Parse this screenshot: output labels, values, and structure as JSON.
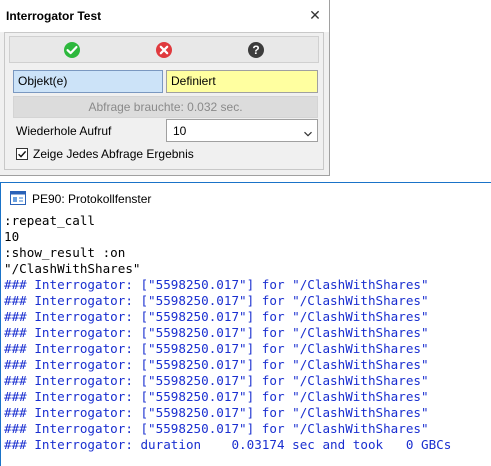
{
  "dialog": {
    "title": "Interrogator Test",
    "close_glyph": "✕",
    "icons": [
      "check-icon",
      "cancel-icon",
      "help-icon"
    ],
    "colors": {
      "check": "#2db83d",
      "cancel": "#e03a3e",
      "help": "#3c3c3c"
    },
    "objekt_label": "Objekt(e)",
    "objekt_value": "Definiert",
    "timing_text": "Abfrage brauchte:   0.032 sec.",
    "repeat_label": "Wiederhole Aufruf",
    "repeat_value": "10",
    "show_results_label": "Zeige Jedes Abfrage Ergebnis",
    "show_results_checked": true
  },
  "log": {
    "title": "PE90: Protokollfenster",
    "colors": {
      "plain": "#000000",
      "hash": "#1a2fd0"
    },
    "lines": [
      {
        "text": ":repeat_call",
        "style": "plain"
      },
      {
        "text": "10",
        "style": "plain"
      },
      {
        "text": ":show_result :on",
        "style": "plain"
      },
      {
        "text": "\"/ClashWithShares\"",
        "style": "plain"
      },
      {
        "text": "### Interrogator: [\"5598250.017\"] for \"/ClashWithShares\"",
        "style": "hash"
      },
      {
        "text": "### Interrogator: [\"5598250.017\"] for \"/ClashWithShares\"",
        "style": "hash"
      },
      {
        "text": "### Interrogator: [\"5598250.017\"] for \"/ClashWithShares\"",
        "style": "hash"
      },
      {
        "text": "### Interrogator: [\"5598250.017\"] for \"/ClashWithShares\"",
        "style": "hash"
      },
      {
        "text": "### Interrogator: [\"5598250.017\"] for \"/ClashWithShares\"",
        "style": "hash"
      },
      {
        "text": "### Interrogator: [\"5598250.017\"] for \"/ClashWithShares\"",
        "style": "hash"
      },
      {
        "text": "### Interrogator: [\"5598250.017\"] for \"/ClashWithShares\"",
        "style": "hash"
      },
      {
        "text": "### Interrogator: [\"5598250.017\"] for \"/ClashWithShares\"",
        "style": "hash"
      },
      {
        "text": "### Interrogator: [\"5598250.017\"] for \"/ClashWithShares\"",
        "style": "hash"
      },
      {
        "text": "### Interrogator: [\"5598250.017\"] for \"/ClashWithShares\"",
        "style": "hash"
      },
      {
        "text": "### Interrogator: duration    0.03174 sec and took   0 GBCs",
        "style": "hash"
      }
    ]
  }
}
